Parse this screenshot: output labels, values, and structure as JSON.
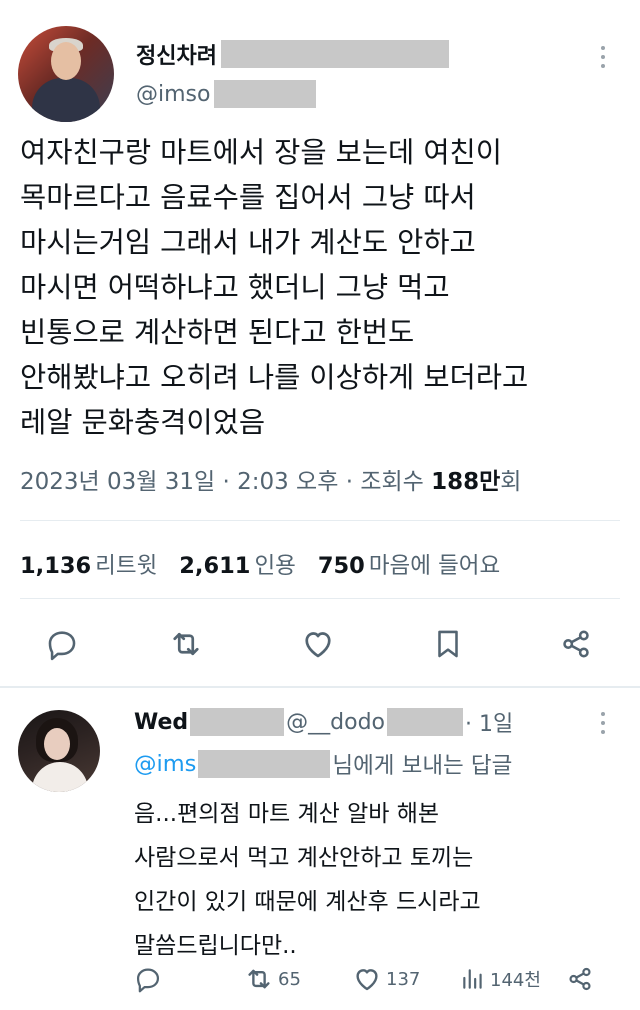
{
  "tweet": {
    "display_name": "정신차려",
    "handle": "@imso",
    "text_lines": [
      "여자친구랑 마트에서 장을 보는데 여친이",
      "목마르다고 음료수를 집어서 그냥 따서",
      "마시는거임 그래서 내가 계산도 안하고",
      "마시면 어떡하냐고 했더니 그냥 먹고",
      "빈통으로 계산하면 된다고 한번도",
      "안해봤냐고 오히려 나를 이상하게 보더라고",
      "레알 문화충격이었음"
    ],
    "timestamp": "2023년 03월 31일 · 2:03 오후 · 조회수 ",
    "views_value": "188만",
    "views_suffix": "회",
    "retweets_count": "1,136",
    "retweets_label": "리트윗",
    "quotes_count": "2,611",
    "quotes_label": "인용",
    "likes_count": "750",
    "likes_label": "마음에 들어요"
  },
  "reply": {
    "display_name": "Wed",
    "handle": "@__dodo",
    "time": "· 1일",
    "reply_prefix": "@ims",
    "reply_suffix": "님에게 보내는 답글",
    "text_lines": [
      "음...편의점 마트 계산 알바 해본",
      "사람으로서 먹고 계산안하고 토끼는",
      "인간이 있기 때문에 계산후 드시라고",
      "말씀드립니다만.."
    ],
    "retweets": "65",
    "likes": "137",
    "views": "144천"
  },
  "icons": {
    "reply": "reply-icon",
    "retweet": "retweet-icon",
    "like": "heart-icon",
    "bookmark": "bookmark-icon",
    "share": "share-icon",
    "views": "views-icon",
    "more": "more-icon"
  },
  "colors": {
    "text": "#0f1419",
    "secondary": "#536471",
    "link": "#1d9bf0",
    "divider": "#e6ecf0"
  }
}
